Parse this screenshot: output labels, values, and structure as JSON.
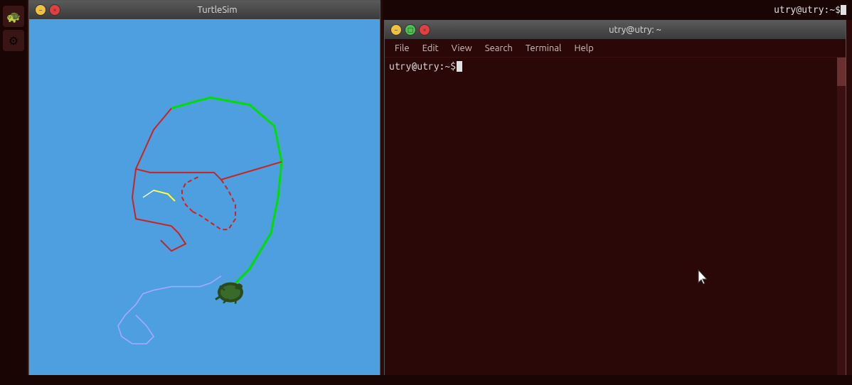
{
  "desktop": {
    "topbar_title": "utry@utry:~$",
    "cursor_visible": true
  },
  "turtlesim": {
    "title": "TurtleSim",
    "min_btn": "−",
    "max_btn": "□",
    "close_btn": "×",
    "canvas_color": "#4d9fdf"
  },
  "terminal": {
    "title": "utry@utry: ~",
    "min_btn": "−",
    "max_btn": "□",
    "close_btn": "×",
    "menu": {
      "file": "File",
      "edit": "Edit",
      "view": "View",
      "search": "Search",
      "terminal": "Terminal",
      "help": "Help"
    },
    "prompt": "utry@utry:~$ "
  },
  "sidebar": {
    "icons": [
      "🐢",
      "⚙"
    ]
  }
}
